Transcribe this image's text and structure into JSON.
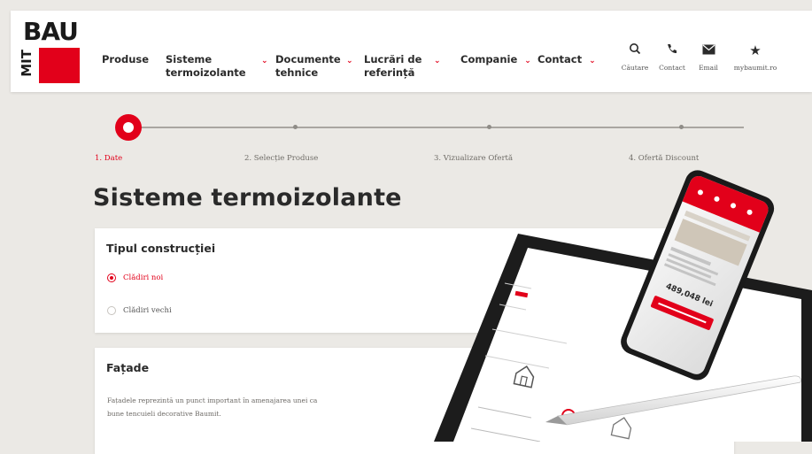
{
  "brand": {
    "logo_text": "BAU",
    "logo_vertical": "MIT",
    "brand_red": "#e2001a"
  },
  "nav": {
    "items": [
      {
        "label": "Produse",
        "has_dropdown": false
      },
      {
        "label": "Sisteme termoizolante",
        "has_dropdown": true
      },
      {
        "label": "Documente tehnice",
        "has_dropdown": true
      },
      {
        "label": "Lucrări de referință",
        "has_dropdown": true
      },
      {
        "label": "Companie",
        "has_dropdown": true
      },
      {
        "label": "Contact",
        "has_dropdown": true
      }
    ]
  },
  "tools": [
    {
      "icon": "search-icon",
      "label": "Căutare"
    },
    {
      "icon": "phone-icon",
      "label": "Contact"
    },
    {
      "icon": "email-icon",
      "label": "Email"
    },
    {
      "icon": "star-icon",
      "label": "mybaumit.ro"
    }
  ],
  "steps": [
    {
      "label": "1. Date",
      "active": true
    },
    {
      "label": "2. Selecție Produse",
      "active": false
    },
    {
      "label": "3. Vizualizare Ofertă",
      "active": false
    },
    {
      "label": "4. Ofertă Discount",
      "active": false
    }
  ],
  "page_title": "Sisteme termoizolante",
  "construction": {
    "title": "Tipul construcției",
    "options": [
      {
        "label": "Clădiri noi",
        "selected": true
      },
      {
        "label": "Clădiri vechi",
        "selected": false
      }
    ]
  },
  "facade": {
    "title": "Fațade",
    "description_line1": "Fațadele reprezintă un punct important în amenajarea unei ca",
    "description_line2": "bune tencuieli decorative Baumit."
  },
  "phone_price": "489,048 lei"
}
